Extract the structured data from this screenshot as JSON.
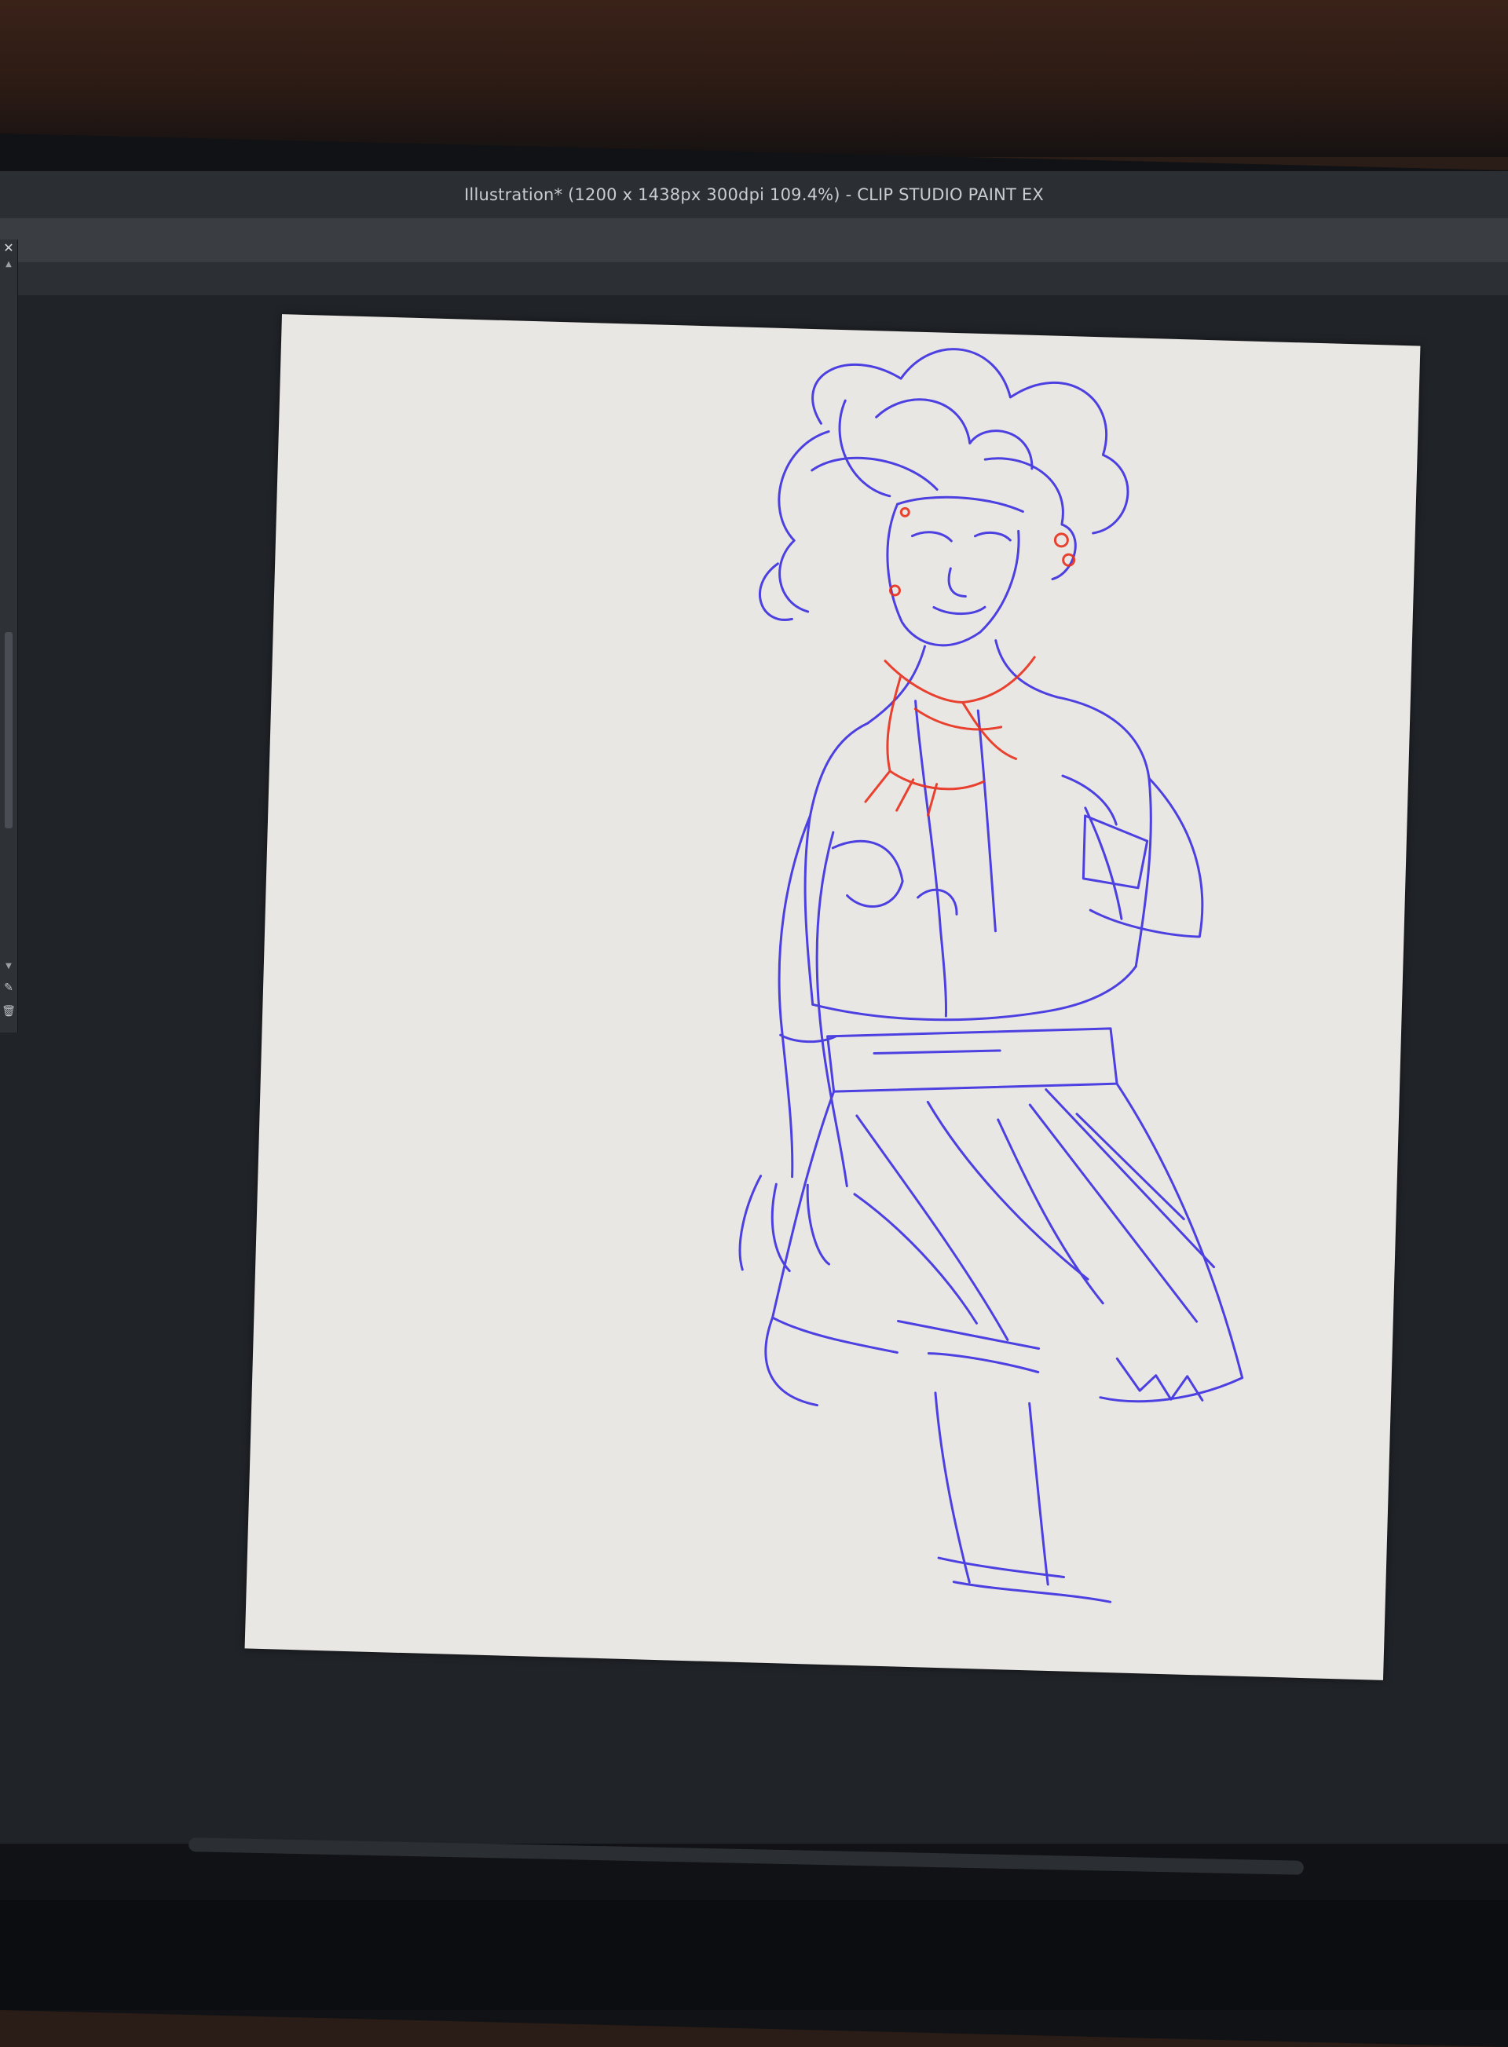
{
  "window": {
    "title": "Illustration* (1200 x 1438px 300dpi 109.4%)  - CLIP STUDIO PAINT EX"
  },
  "side_panel": {
    "close_glyph": "✕",
    "scroll_up_glyph": "▲",
    "scroll_down_glyph": "▼",
    "pen_glyph": "✎",
    "trash_glyph": "🗑"
  },
  "canvas": {
    "paper_color": "#e9e7e4",
    "stroke_colors": {
      "sketch": "#3c2ee0",
      "accent": "#e8301c"
    }
  },
  "icons": [
    "close-icon",
    "scroll-up-icon",
    "scroll-down-icon",
    "pen-icon",
    "trash-icon"
  ]
}
